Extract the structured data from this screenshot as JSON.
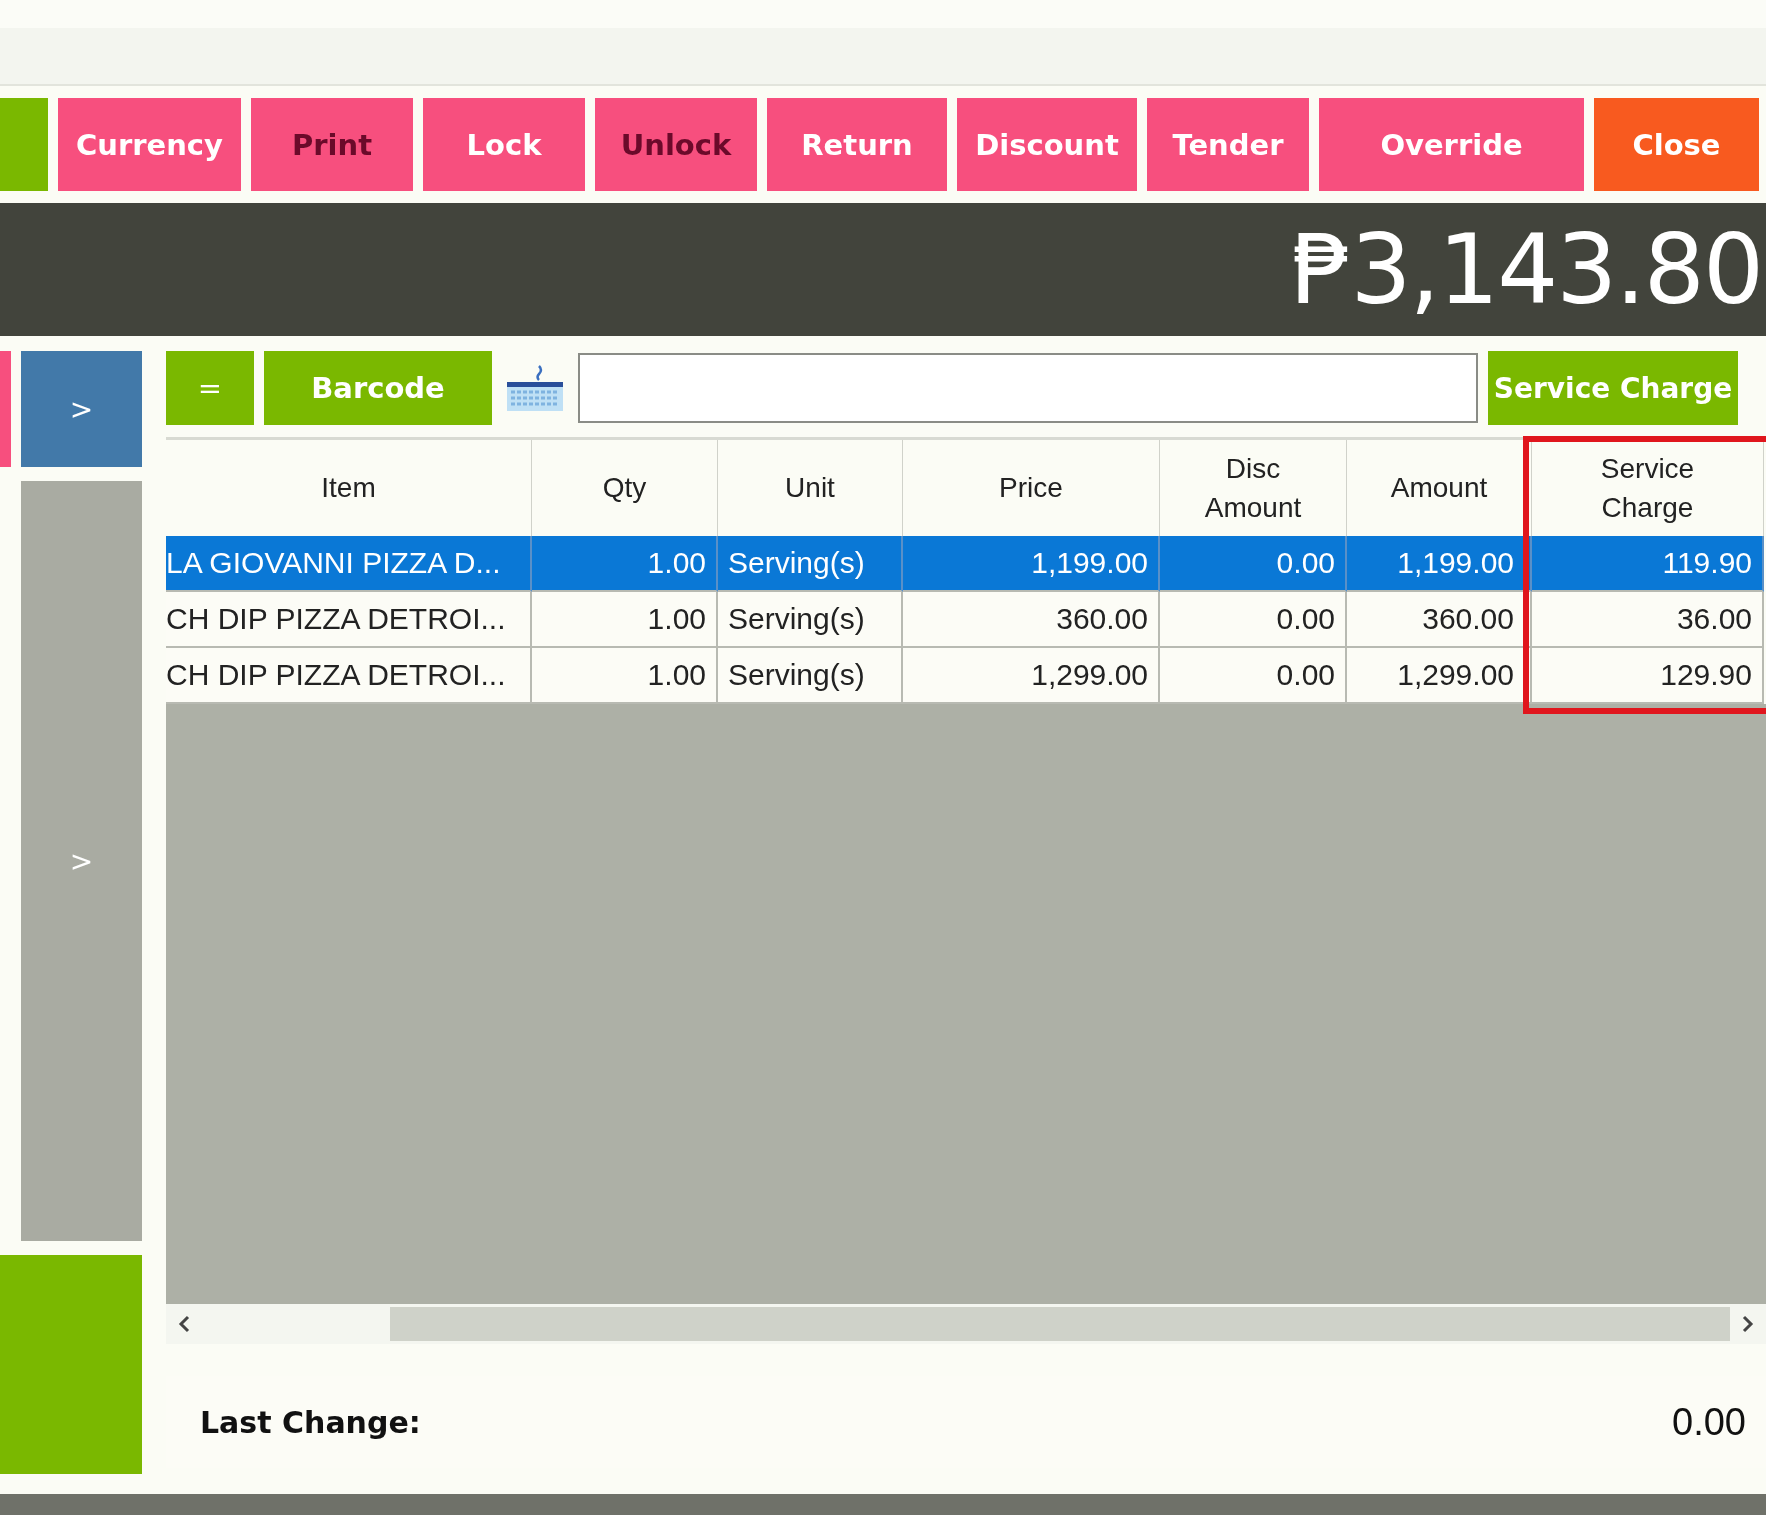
{
  "toolbar": {
    "buttons": [
      {
        "kind": "green"
      },
      {
        "kind": "pink",
        "label": "Currency"
      },
      {
        "kind": "pink-dark",
        "label": "Print"
      },
      {
        "kind": "pink",
        "label": "Lock"
      },
      {
        "kind": "pink-dark",
        "label": "Unlock"
      },
      {
        "kind": "pink",
        "label": "Return"
      },
      {
        "kind": "pink",
        "label": "Discount"
      },
      {
        "kind": "pink",
        "label": "Tender"
      },
      {
        "kind": "pink",
        "label": "Override"
      },
      {
        "kind": "orange",
        "label": "Close"
      }
    ]
  },
  "total": "₱3,143.80",
  "sidebar": {
    "buttons": [
      {
        "kind": "blue",
        "label": ">"
      },
      {
        "kind": "gray",
        "label": ">"
      },
      {
        "kind": "green"
      }
    ]
  },
  "entry": {
    "equals_button": "=",
    "barcode_button": "Barcode",
    "service_charge_button": "Service Charge"
  },
  "table": {
    "columns": [
      "Item",
      "Qty",
      "Unit",
      "Price",
      "Disc Amount",
      "Amount",
      "Service Charge"
    ],
    "rows": [
      {
        "selected": true,
        "cells": [
          "LA GIOVANNI PIZZA D...",
          "1.00",
          "Serving(s)",
          "1,199.00",
          "0.00",
          "1,199.00",
          "119.90"
        ]
      },
      {
        "selected": false,
        "cells": [
          "CH DIP PIZZA DETROI...",
          "1.00",
          "Serving(s)",
          "360.00",
          "0.00",
          "360.00",
          "36.00"
        ]
      },
      {
        "selected": false,
        "cells": [
          "CH DIP PIZZA DETROI...",
          "1.00",
          "Serving(s)",
          "1,299.00",
          "0.00",
          "1,299.00",
          "129.90"
        ]
      }
    ]
  },
  "last_change": {
    "label": "Last Change:",
    "value": "0.00"
  }
}
